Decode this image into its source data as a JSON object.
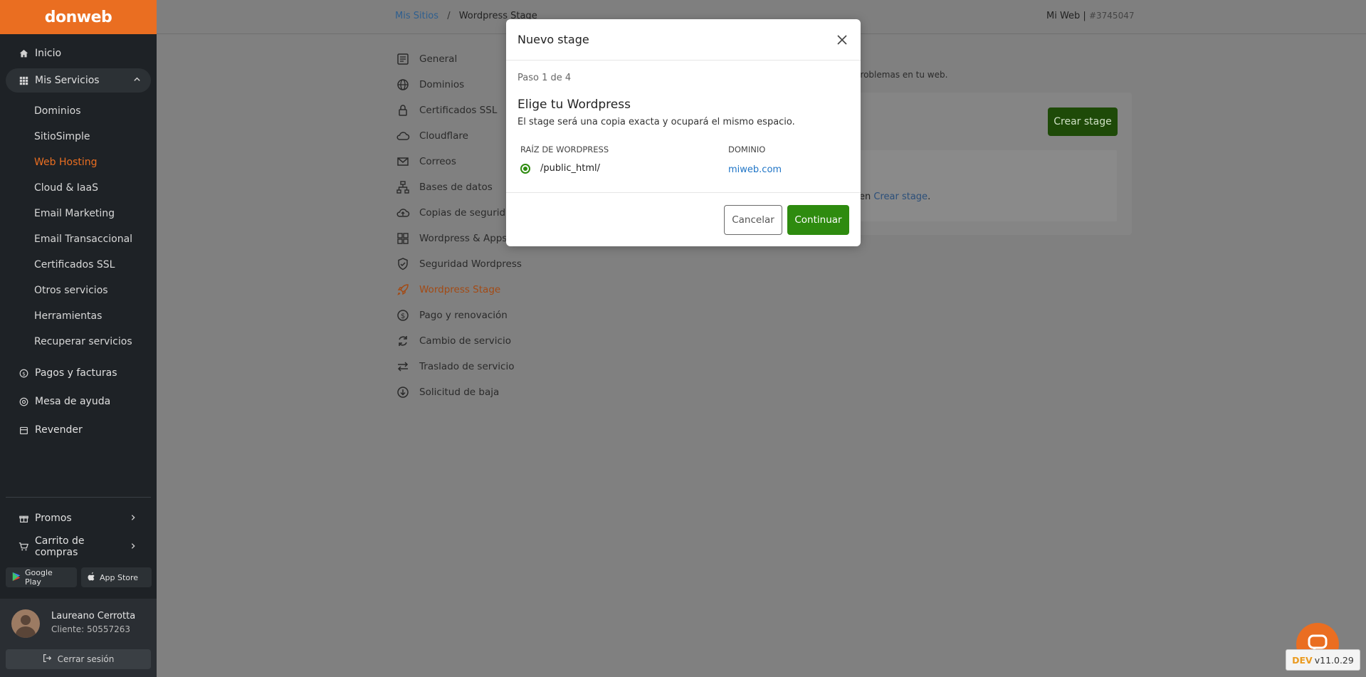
{
  "brand": "donweb",
  "sidebar": {
    "inicio": "Inicio",
    "mis_servicios": "Mis Servicios",
    "sub_items": [
      "Dominios",
      "SitioSimple",
      "Web Hosting",
      "Cloud & IaaS",
      "Email Marketing",
      "Email Transaccional",
      "Certificados SSL",
      "Otros servicios",
      "Herramientas",
      "Recuperar servicios"
    ],
    "pagos": "Pagos y facturas",
    "mesa": "Mesa de ayuda",
    "revender": "Revender",
    "promos": "Promos",
    "carrito": "Carrito de compras",
    "google_play": "Google Play",
    "app_store": "App Store",
    "user_name": "Laureano Cerrotta",
    "user_client": "Cliente: 50557263",
    "logout": "Cerrar sesión"
  },
  "topbar": {
    "breadcrumb_link": "Mis Sitios",
    "breadcrumb_sep": "/",
    "breadcrumb_current": "Wordpress Stage",
    "site_name": "Mi Web |",
    "site_id": "#3745047"
  },
  "service_menu": [
    "General",
    "Dominios",
    "Certificados SSL",
    "Cloudflare",
    "Correos",
    "Bases de datos",
    "Copias de seguridad",
    "Wordpress & Apps",
    "Seguridad Wordpress",
    "Wordpress Stage",
    "Pago y renovación",
    "Cambio de servicio",
    "Traslado de servicio",
    "Solicitud de baja"
  ],
  "content": {
    "subtitle_fragment": "tar problemas en tu web.",
    "crear_stage": "Crear stage",
    "inner_prefix": "en",
    "inner_link": "Crear stage",
    "inner_suffix": "."
  },
  "modal": {
    "title": "Nuevo stage",
    "step": "Paso 1 de 4",
    "heading": "Elige tu Wordpress",
    "description": "El stage será una copia exacta y ocupará el mismo espacio.",
    "col_root": "RAÍZ DE WORDPRESS",
    "col_domain": "DOMINIO",
    "row_path": "/public_html/",
    "row_domain": "miweb.com",
    "cancel": "Cancelar",
    "continue": "Continuar"
  },
  "dev_badge": {
    "tag": "DEV",
    "version": "v11.0.29"
  },
  "colors": {
    "brand_orange": "#ea6e21",
    "sidebar_bg": "#1e2226",
    "primary_green": "#2e8b0f",
    "link_blue": "#1e74c6"
  }
}
